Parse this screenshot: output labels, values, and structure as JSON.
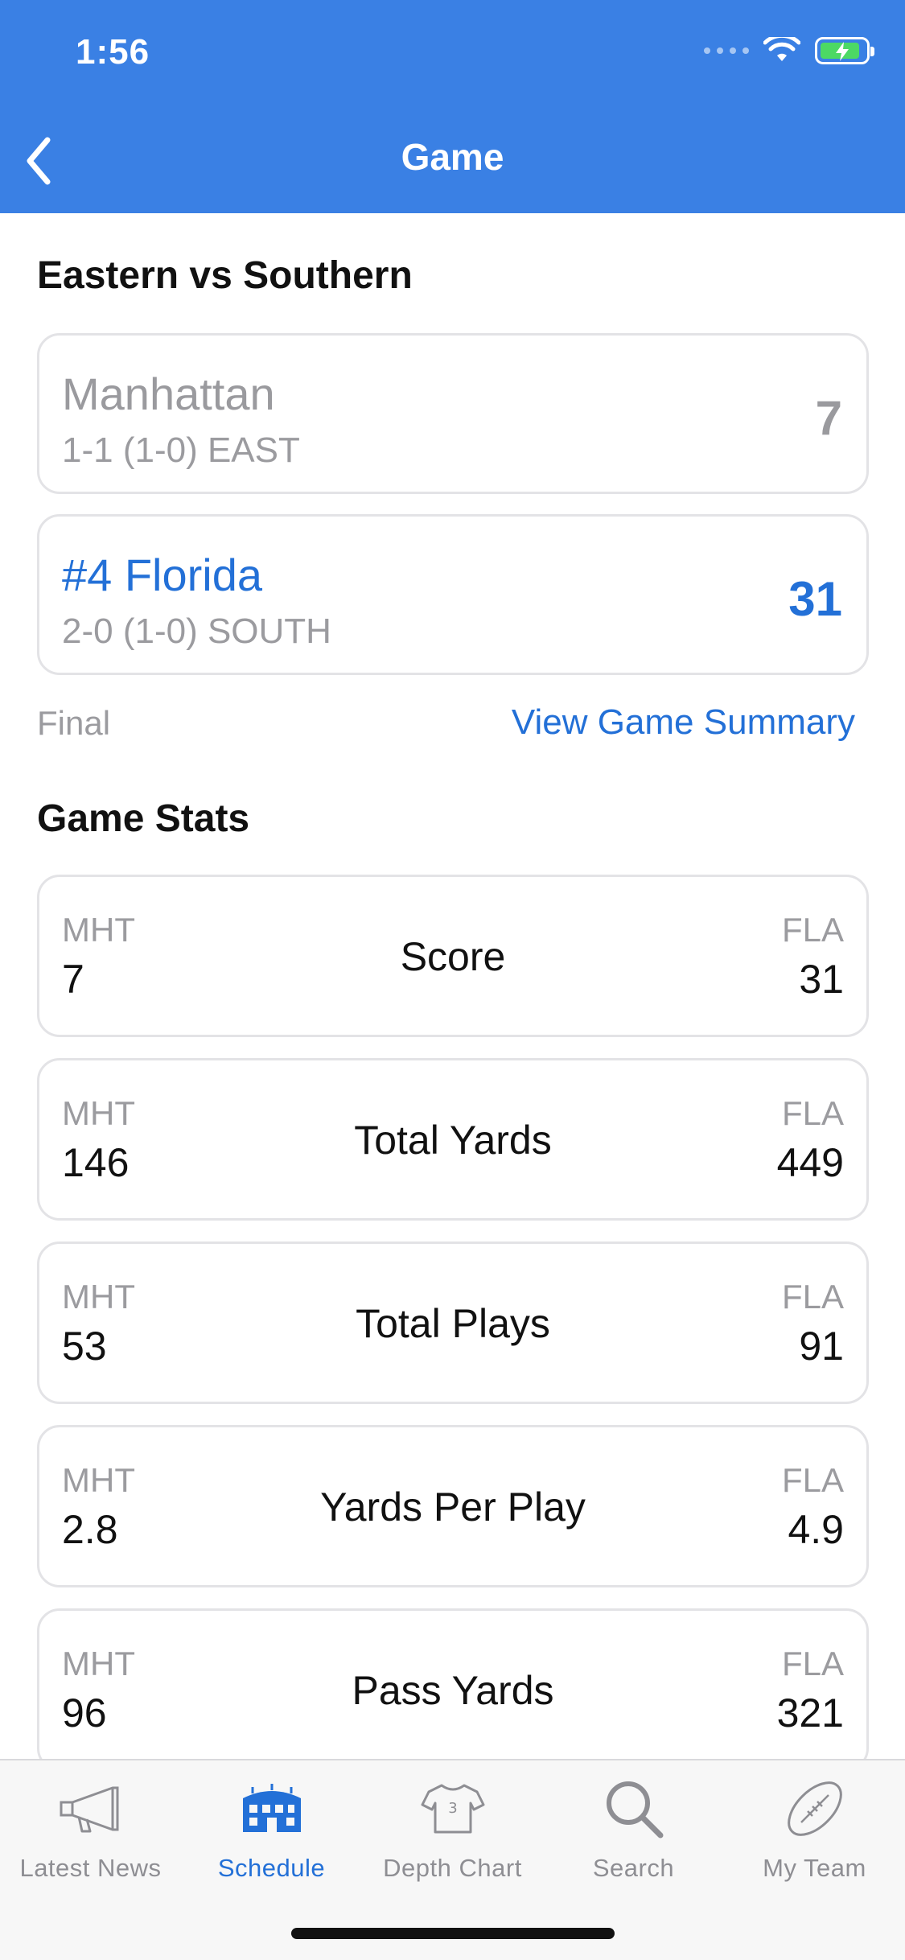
{
  "status_bar": {
    "time": "1:56"
  },
  "nav": {
    "title": "Game"
  },
  "matchup": {
    "title": "Eastern vs Southern",
    "away": {
      "name": "Manhattan",
      "record": "1-1 (1-0) EAST",
      "score": "7"
    },
    "home": {
      "name": "#4 Florida",
      "record": "2-0 (1-0) SOUTH",
      "score": "31"
    },
    "status": "Final",
    "summary_link": "View Game Summary"
  },
  "stats": {
    "title": "Game Stats",
    "rows": [
      {
        "left_abbr": "MHT",
        "left_value": "7",
        "label": "Score",
        "right_abbr": "FLA",
        "right_value": "31"
      },
      {
        "left_abbr": "MHT",
        "left_value": "146",
        "label": "Total Yards",
        "right_abbr": "FLA",
        "right_value": "449"
      },
      {
        "left_abbr": "MHT",
        "left_value": "53",
        "label": "Total Plays",
        "right_abbr": "FLA",
        "right_value": "91"
      },
      {
        "left_abbr": "MHT",
        "left_value": "2.8",
        "label": "Yards Per Play",
        "right_abbr": "FLA",
        "right_value": "4.9"
      },
      {
        "left_abbr": "MHT",
        "left_value": "96",
        "label": "Pass Yards",
        "right_abbr": "FLA",
        "right_value": "321"
      }
    ]
  },
  "tabs": [
    {
      "label": "Latest News",
      "icon": "megaphone-icon",
      "active": false
    },
    {
      "label": "Schedule",
      "icon": "stadium-icon",
      "active": true
    },
    {
      "label": "Depth Chart",
      "icon": "jersey-icon",
      "active": false
    },
    {
      "label": "Search",
      "icon": "search-icon",
      "active": false
    },
    {
      "label": "My Team",
      "icon": "football-icon",
      "active": false
    }
  ],
  "colors": {
    "header": "#3a80e4",
    "accent": "#2370d7",
    "muted": "#9b9b9f"
  }
}
